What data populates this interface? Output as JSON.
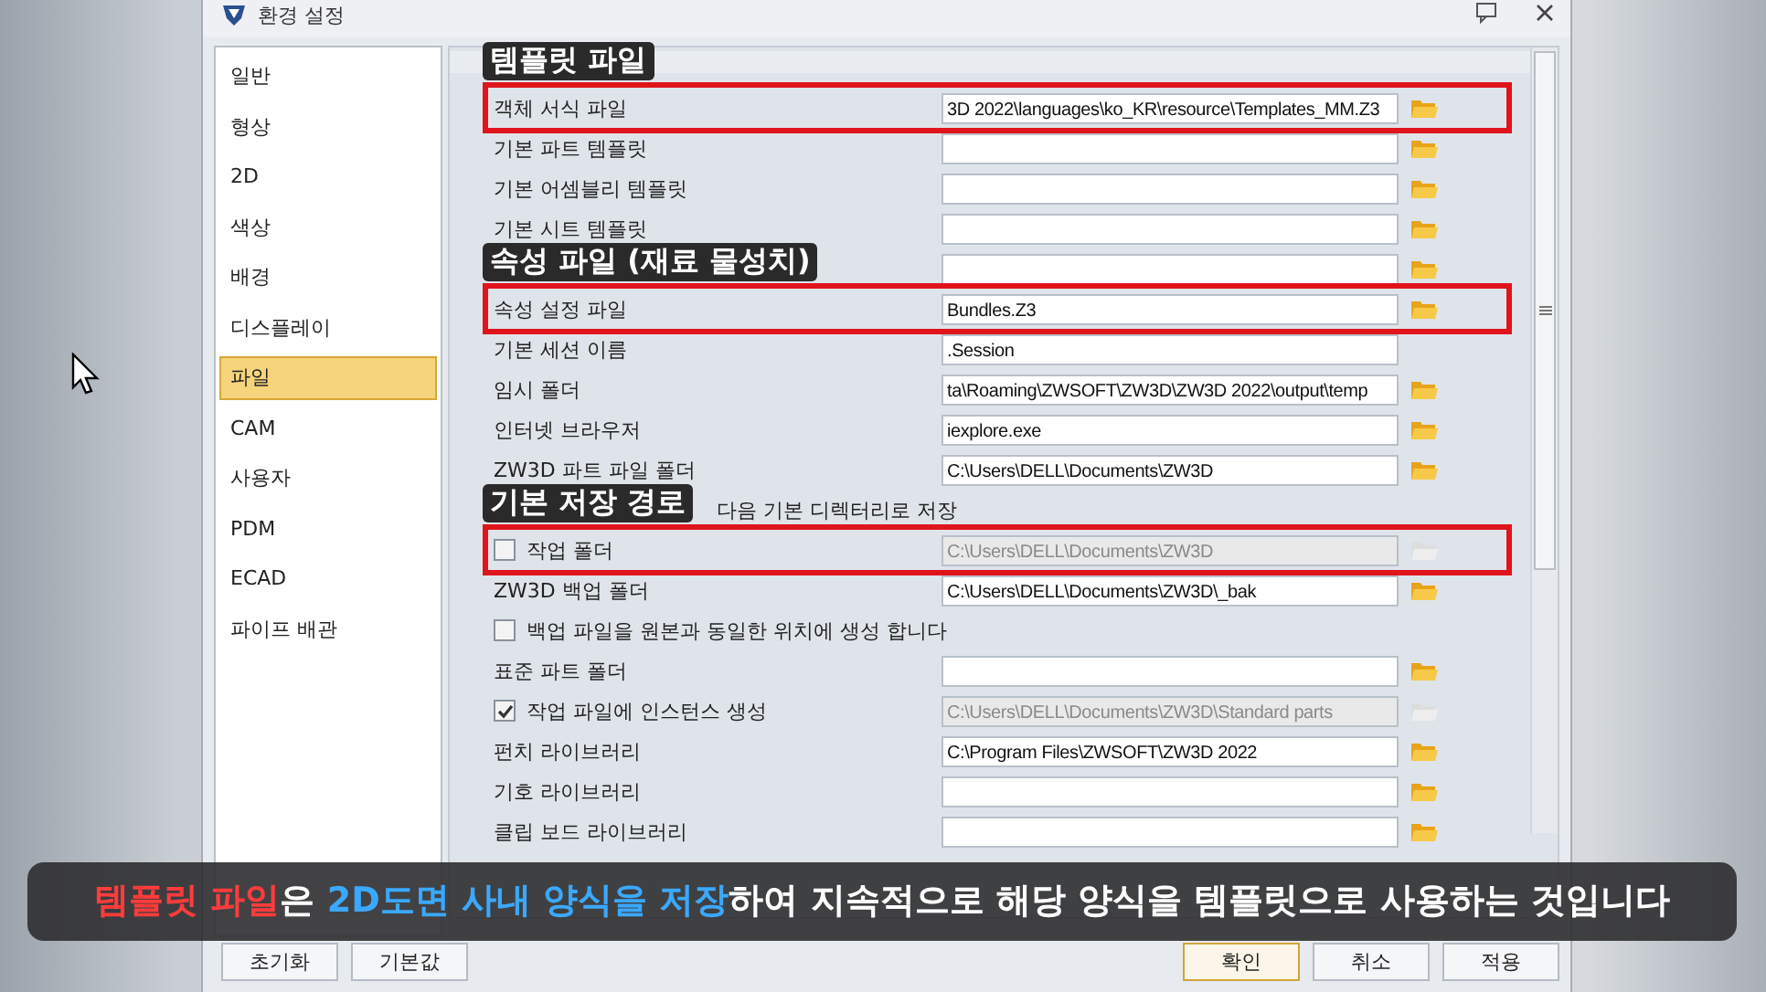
{
  "window": {
    "title": "환경 설정"
  },
  "sidebar": {
    "items": [
      {
        "label": "일반",
        "selected": false
      },
      {
        "label": "형상",
        "selected": false
      },
      {
        "label": "2D",
        "selected": false
      },
      {
        "label": "색상",
        "selected": false
      },
      {
        "label": "배경",
        "selected": false
      },
      {
        "label": "디스플레이",
        "selected": false
      },
      {
        "label": "파일",
        "selected": true
      },
      {
        "label": "CAM",
        "selected": false
      },
      {
        "label": "사용자",
        "selected": false
      },
      {
        "label": "PDM",
        "selected": false
      },
      {
        "label": "ECAD",
        "selected": false
      },
      {
        "label": "파이프 배관",
        "selected": false
      }
    ]
  },
  "settings": {
    "rows": [
      {
        "kind": "field",
        "label": "객체 서식 파일",
        "value": "3D 2022\\languages\\ko_KR\\resource\\Templates_MM.Z3",
        "browse": true,
        "highlighted": true,
        "annotation": "템플릿 파일"
      },
      {
        "kind": "field",
        "label": "기본 파트 템플릿",
        "browse": true
      },
      {
        "kind": "field",
        "label": "기본 어셈블리 템플릿",
        "browse": true
      },
      {
        "kind": "field",
        "label": "기본 시트 템플릿",
        "browse": true
      },
      {
        "kind": "field",
        "browse": true
      },
      {
        "kind": "field",
        "label": "속성 설정 파일",
        "value": "Bundles.Z3",
        "browse": true,
        "highlighted": true,
        "annotation": "속성 파일 (재료 물성치)"
      },
      {
        "kind": "field",
        "label": "기본 세션 이름",
        "value": ".Session",
        "browse": false
      },
      {
        "kind": "field",
        "label": "임시 폴더",
        "value": "ta\\Roaming\\ZWSOFT\\ZW3D\\ZW3D 2022\\output\\temp",
        "browse": true
      },
      {
        "kind": "field",
        "label": "인터넷 브라우저",
        "value": "iexplore.exe",
        "browse": true
      },
      {
        "kind": "field",
        "label": "ZW3D 파트 파일 폴더",
        "value": "C:\\Users\\DELL\\Documents\\ZW3D",
        "browse": true
      },
      {
        "kind": "covered",
        "label": "다음 기본 디렉터리로 저장"
      },
      {
        "kind": "checkfield",
        "label": "작업 폴더",
        "checked": false,
        "disabled": true,
        "value": "C:\\Users\\DELL\\Documents\\ZW3D",
        "browse": true,
        "highlighted": true,
        "annotation": "기본 저장 경로"
      },
      {
        "kind": "field",
        "label": "ZW3D 백업 폴더",
        "value": "C:\\Users\\DELL\\Documents\\ZW3D\\_bak",
        "browse": true
      },
      {
        "kind": "checkbox",
        "label": "백업 파일을 원본과 동일한 위치에 생성 합니다",
        "checked": false
      },
      {
        "kind": "field",
        "label": "표준 파트 폴더",
        "browse": true
      },
      {
        "kind": "checkfield",
        "label": "작업 파일에 인스턴스 생성",
        "checked": true,
        "disabled": true,
        "value": "C:\\Users\\DELL\\Documents\\ZW3D\\Standard parts",
        "browse": true
      },
      {
        "kind": "field",
        "label": "펀치 라이브러리",
        "value": "C:\\Program Files\\ZWSOFT\\ZW3D 2022",
        "browse": true
      },
      {
        "kind": "field",
        "label": "기호 라이브러리",
        "browse": true
      },
      {
        "kind": "field",
        "label": "클립 보드 라이브러리",
        "browse": true
      }
    ]
  },
  "buttons_left": [
    {
      "label": "초기화",
      "default": false
    },
    {
      "label": "기본값",
      "default": false
    }
  ],
  "buttons_right": [
    {
      "label": "확인",
      "default": true
    },
    {
      "label": "취소",
      "default": false
    },
    {
      "label": "적용",
      "default": false
    }
  ],
  "caption": {
    "segments": [
      {
        "text": "템플릿 파일",
        "color": "#ff3b3b"
      },
      {
        "text": "은 ",
        "color": "#ffffff"
      },
      {
        "text": "2D도면 사내 양식을 저장",
        "color": "#3aa8ff"
      },
      {
        "text": "하여 지속적으로 해당 양식을 템플릿으로 사용하는 것입니다",
        "color": "#ffffff"
      }
    ]
  }
}
